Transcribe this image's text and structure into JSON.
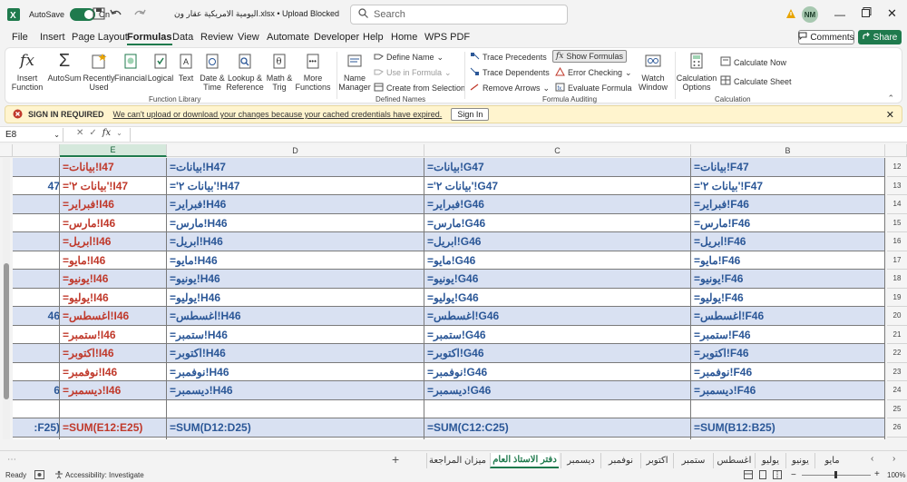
{
  "titlebar": {
    "autosave_label": "AutoSave",
    "autosave_state": "On",
    "title": "اليومية الامريكية عقار ون.xlsx • Upload Blocked",
    "search_placeholder": "Search",
    "user_initials": "NM"
  },
  "menu": {
    "items": [
      "File",
      "Insert",
      "Page Layout",
      "Formulas",
      "Data",
      "Review",
      "View",
      "Automate",
      "Developer",
      "Help",
      "Home",
      "WPS PDF"
    ],
    "active": "Formulas",
    "comments_label": "Comments",
    "share_label": "Share"
  },
  "ribbon": {
    "insert_function": [
      "Insert",
      "Function"
    ],
    "autosum": "AutoSum",
    "recently_used": [
      "Recently",
      "Used"
    ],
    "financial": "Financial",
    "logical": "Logical",
    "text": "Text",
    "date_time": [
      "Date &",
      "Time"
    ],
    "lookup_reference": [
      "Lookup &",
      "Reference"
    ],
    "math_trig": [
      "Math &",
      "Trig"
    ],
    "more_functions": [
      "More",
      "Functions"
    ],
    "name_manager": [
      "Name",
      "Manager"
    ],
    "define_name": "Define Name",
    "use_in_formula": "Use in Formula",
    "create_from_selection": "Create from Selection",
    "trace_precedents": "Trace Precedents",
    "trace_dependents": "Trace Dependents",
    "remove_arrows": "Remove Arrows",
    "show_formulas": "Show Formulas",
    "error_checking": "Error Checking",
    "evaluate_formula": "Evaluate Formula",
    "watch_window": [
      "Watch",
      "Window"
    ],
    "calculation_options": [
      "Calculation",
      "Options"
    ],
    "calculate_now": "Calculate Now",
    "calculate_sheet": "Calculate Sheet",
    "groups": {
      "function_library": "Function Library",
      "defined_names": "Defined Names",
      "formula_auditing": "Formula Auditing",
      "calculation": "Calculation"
    }
  },
  "message_bar": {
    "title": "SIGN IN REQUIRED",
    "text": "We can't upload or download your changes because your cached credentials have expired.",
    "button": "Sign In"
  },
  "formula_bar": {
    "name_box": "E8",
    "fx": "fx",
    "content": ""
  },
  "columns": [
    "E",
    "D",
    "C",
    "B"
  ],
  "selected_column": "E",
  "rows": [
    {
      "num": "12",
      "F": "",
      "E": "=بيانات!I47",
      "D": "=بيانات!H47",
      "C": "=بيانات!G47",
      "B": "=بيانات!F47",
      "band": true
    },
    {
      "num": "13",
      "F": "47",
      "E": "='بيانات ٢'!I47",
      "D": "='بيانات ٢'!H47",
      "C": "='بيانات ٢'!G47",
      "B": "='بيانات ٢'!F47",
      "band": false
    },
    {
      "num": "14",
      "F": "",
      "E": "=فبراير!I46",
      "D": "=فبراير!H46",
      "C": "=فبراير!G46",
      "B": "=فبراير!F46",
      "band": true
    },
    {
      "num": "15",
      "F": "",
      "E": "=مارس!I46",
      "D": "=مارس!H46",
      "C": "=مارس!G46",
      "B": "=مارس!F46",
      "band": false
    },
    {
      "num": "16",
      "F": "",
      "E": "=ابريل!I46",
      "D": "=ابريل!H46",
      "C": "=ابريل!G46",
      "B": "=ابريل!F46",
      "band": true
    },
    {
      "num": "17",
      "F": "",
      "E": "=مايو!I46",
      "D": "=مايو!H46",
      "C": "=مايو!G46",
      "B": "=مايو!F46",
      "band": false
    },
    {
      "num": "18",
      "F": "",
      "E": "=يونيو!I46",
      "D": "=يونيو!H46",
      "C": "=يونيو!G46",
      "B": "=يونيو!F46",
      "band": true
    },
    {
      "num": "19",
      "F": "",
      "E": "=يوليو!I46",
      "D": "=يوليو!H46",
      "C": "=يوليو!G46",
      "B": "=يوليو!F46",
      "band": false
    },
    {
      "num": "20",
      "F": "46",
      "E": "=اغسطس!I46",
      "D": "=اغسطس!H46",
      "C": "=اغسطس!G46",
      "B": "=اغسطس!F46",
      "band": true
    },
    {
      "num": "21",
      "F": "",
      "E": "=ستمبر!I46",
      "D": "=ستمبر!H46",
      "C": "=ستمبر!G46",
      "B": "=ستمبر!F46",
      "band": false
    },
    {
      "num": "22",
      "F": "",
      "E": "=اكتوبر!I46",
      "D": "=اكتوبر!H46",
      "C": "=اكتوبر!G46",
      "B": "=اكتوبر!F46",
      "band": true
    },
    {
      "num": "23",
      "F": "",
      "E": "=نوفمبر!I46",
      "D": "=نوفمبر!H46",
      "C": "=نوفمبر!G46",
      "B": "=نوفمبر!F46",
      "band": false
    },
    {
      "num": "24",
      "F": "6",
      "E": "=ديسمبر!I46",
      "D": "=ديسمبر!H46",
      "C": "=ديسمبر!G46",
      "B": "=ديسمبر!F46",
      "band": true
    },
    {
      "num": "25",
      "F": "",
      "E": "",
      "D": "",
      "C": "",
      "B": "",
      "band": false
    },
    {
      "num": "26",
      "F": ":F25)",
      "E": "=SUM(E12:E25)",
      "D": "=SUM(D12:D25)",
      "C": "=SUM(C12:C25)",
      "B": "=SUM(B12:B25)",
      "band": true
    }
  ],
  "sheet_tabs": [
    "ميزان المراجعة",
    "دفتر الاستاذ العام",
    "ديسمبر",
    "نوفمبر",
    "اكتوبر",
    "ستمبر",
    "اغسطس",
    "يوليو",
    "يونيو",
    "مايو"
  ],
  "active_tab": "دفتر الاستاذ العام",
  "status": {
    "ready": "Ready",
    "accessibility": "Accessibility: Investigate",
    "zoom": "100%"
  },
  "colors": {
    "excel_green": "#1f7a4d",
    "red_formula": "#c0392b",
    "blue_formula": "#2b5797",
    "band_fill": "#d9e1f2",
    "message_bg": "#fff4ce"
  }
}
